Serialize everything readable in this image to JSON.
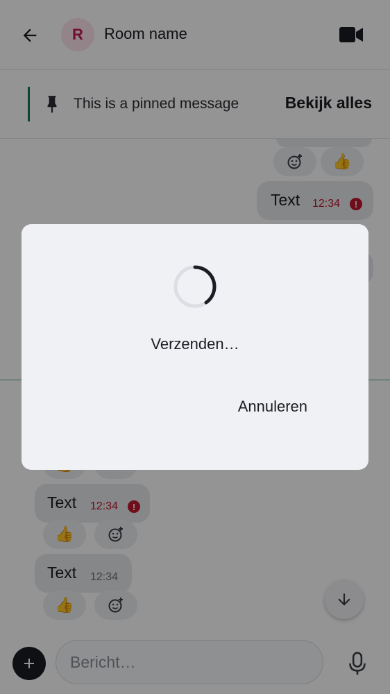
{
  "header": {
    "avatar_letter": "R",
    "room_name": "Room name"
  },
  "pinned": {
    "text": "This is a pinned message",
    "view_all_label": "Bekijk alles"
  },
  "messages": [
    {
      "text": "Text",
      "time": "12:34",
      "failed": true
    },
    {
      "text": "Text",
      "time": "12:34",
      "failed": true
    },
    {
      "text": "Text",
      "time": "12:34",
      "failed": false
    }
  ],
  "reactions": {
    "thumbs_up": "👍"
  },
  "composer": {
    "placeholder": "Bericht…"
  },
  "dialog": {
    "message": "Verzenden…",
    "cancel_label": "Annuleren"
  },
  "colors": {
    "accent": "#0f7a5a",
    "error": "#c2172e",
    "avatar_bg": "#fbe3ea",
    "avatar_fg": "#c51a52"
  }
}
